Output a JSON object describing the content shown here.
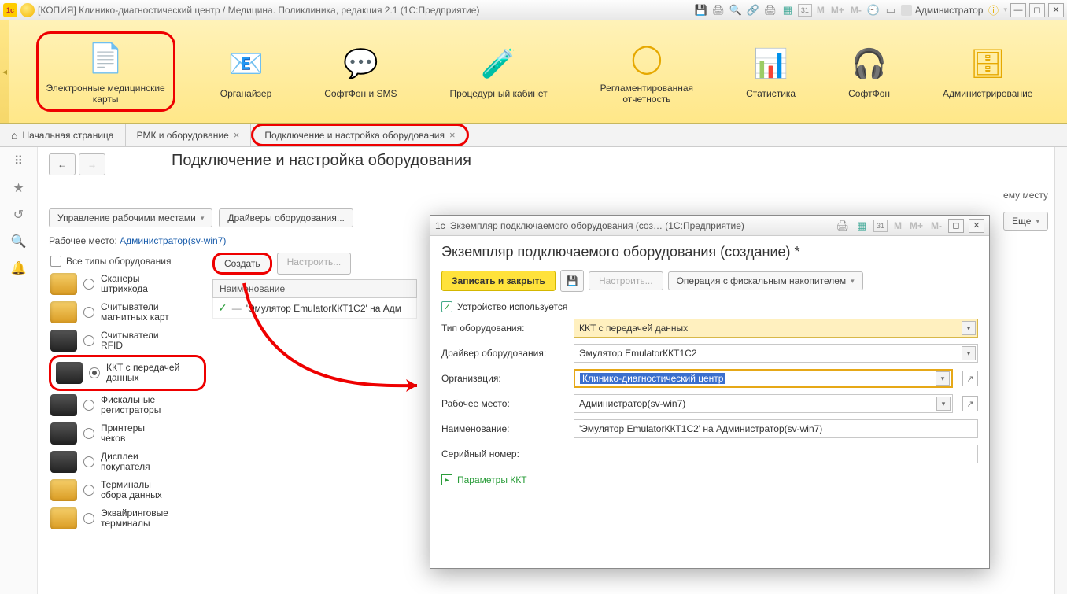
{
  "titlebar": {
    "app_title": "[КОПИЯ] Клинико-диагностический центр / Медицина. Поликлиника, редакция 2.1  (1С:Предприятие)",
    "user": "Администратор",
    "calendar_day": "31",
    "m_labels": [
      "M",
      "M+",
      "M-"
    ]
  },
  "modules": [
    {
      "label": "Электронные медицинские\nкарты"
    },
    {
      "label": "Органайзер"
    },
    {
      "label": "СофтФон и SMS"
    },
    {
      "label": "Процедурный кабинет"
    },
    {
      "label": "Регламентированная\nотчетность"
    },
    {
      "label": "Статистика"
    },
    {
      "label": "СофтФон"
    },
    {
      "label": "Администрирование"
    }
  ],
  "tabs": {
    "home": "Начальная страница",
    "items": [
      {
        "label": "РМК и оборудование"
      },
      {
        "label": "Подключение и настройка оборудования"
      }
    ]
  },
  "page": {
    "title": "Подключение и настройка оборудования",
    "manage_workplaces": "Управление рабочими местами",
    "drivers": "Драйверы оборудования...",
    "workplace_label": "Рабочее место:",
    "workplace_link": "Администратор(sv-win7)",
    "create": "Создать",
    "configure": "Настроить...",
    "all_types": "Все типы оборудования",
    "extra_mesto": "ему месту",
    "more_btn": "Еще"
  },
  "equipment_types": [
    {
      "label": "Сканеры\nштрихкода",
      "dark": false
    },
    {
      "label": "Считыватели\nмагнитных карт",
      "dark": false
    },
    {
      "label": "Считыватели\nRFID",
      "dark": true
    },
    {
      "label": "ККТ с передачей\nданных",
      "dark": true,
      "selected": true,
      "highlight": true
    },
    {
      "label": "Фискальные\nрегистраторы",
      "dark": true
    },
    {
      "label": "Принтеры\nчеков",
      "dark": true
    },
    {
      "label": "Дисплеи\nпокупателя",
      "dark": true
    },
    {
      "label": "Терминалы\nсбора данных",
      "dark": false
    },
    {
      "label": "Эквайринговые\nтерминалы",
      "dark": false
    }
  ],
  "list": {
    "header": "Наименование",
    "row1": "'Эмулятор EmulatorККТ1C2' на Адм"
  },
  "modal": {
    "wintitle": "Экземпляр подключаемого оборудования (соз…   (1С:Предприятие)",
    "heading": "Экземпляр подключаемого оборудования (создание) *",
    "save_close": "Записать и закрыть",
    "config": "Настроить...",
    "fiscal_op": "Операция с фискальным накопителем",
    "device_used": "Устройство используется",
    "fields": {
      "type_label": "Тип оборудования:",
      "type_val": "ККТ с передачей данных",
      "driver_label": "Драйвер оборудования:",
      "driver_val": "Эмулятор EmulatorККТ1C2",
      "org_label": "Организация:",
      "org_val": "Клинико-диагностический центр",
      "wp_label": "Рабочее место:",
      "wp_val": "Администратор(sv-win7)",
      "name_label": "Наименование:",
      "name_val": "'Эмулятор EmulatorККТ1C2' на Администратор(sv-win7)",
      "serial_label": "Серийный номер:",
      "serial_val": ""
    },
    "params_link": "Параметры ККТ",
    "m_labels": [
      "M",
      "M+",
      "M-"
    ],
    "cal_day": "31"
  }
}
